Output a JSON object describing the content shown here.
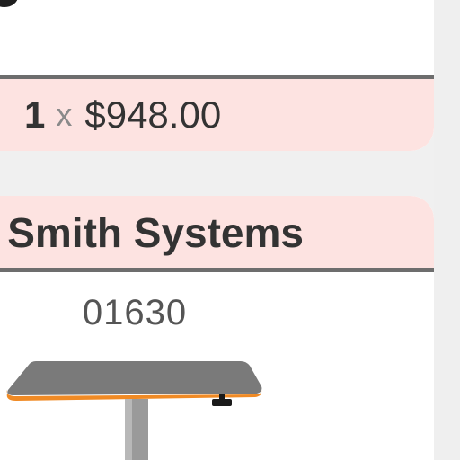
{
  "cart_line": {
    "quantity": "1",
    "times_symbol": "x",
    "price": "$948.00"
  },
  "product": {
    "brand": "Smith Systems",
    "sku": "01630",
    "image_icon": "adjustable-table-image"
  },
  "colors": {
    "header_band": "#fde3e1",
    "rule": "#6d6d6d",
    "table_top": "#7a7a7a",
    "table_edge": "#f08a24"
  }
}
